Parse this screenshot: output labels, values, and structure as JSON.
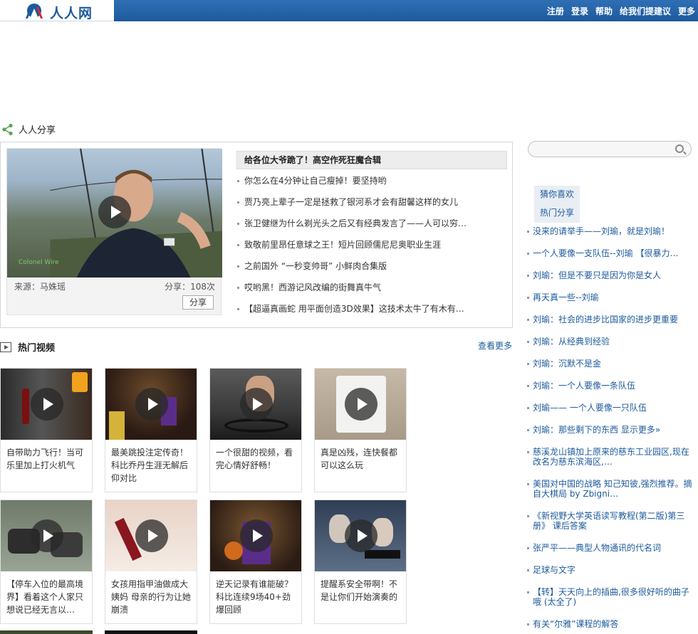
{
  "header": {
    "logo_text": "人人网",
    "nav": [
      "注册",
      "登录",
      "帮助",
      "给我们提建议",
      "更多"
    ]
  },
  "share_section": {
    "title": "人人分享",
    "feature": {
      "source": "来源：马姝瑶",
      "share_count": "分享：108次",
      "share_button": "分享",
      "watermark": "Colonel Wire"
    },
    "headline": "给各位大爷跪了！高空作死狂魔合辑",
    "items": [
      "你怎么在4分钟让自己瘦掉！要坚持哟",
      "贾乃亮上辈子一定是拯救了银河系才会有甜馨这样的女儿",
      "张卫健继为什么剃光头之后又有经典发言了——人可以穷…",
      "致敬前里昂任意球之王！短片回顾儒尼尼奥职业生涯",
      "之前国外 “一秒变帅哥” 小鲜肉合集版",
      "哎哟黑！西游记风改编的街舞真牛气",
      "【超逼真画蛇 用平面创造3D效果】这技术太牛了有木有…"
    ]
  },
  "video_section": {
    "title": "热门视频",
    "more": "查看更多",
    "videos": [
      {
        "caption": "自带助力飞行！当可乐里加上打火机气"
      },
      {
        "caption": "最美跳投注定传奇！科比乔丹生涯无解后仰对比"
      },
      {
        "caption": "一个很甜的视频，看完心情好舒畅！"
      },
      {
        "caption": "真是凶残，连快餐都可以这么玩"
      },
      {
        "caption": "【停车入位的最高境界】看着这个人家只想说已经无言以…"
      },
      {
        "caption": "女孩用指甲油做成大姨妈 母亲的行为让她崩溃"
      },
      {
        "caption": "逆天记录有谁能破？科比连续9场40+劲爆回顾"
      },
      {
        "caption": "提醒系安全带啊！不是让你们开始演奏的"
      }
    ]
  },
  "sidebar": {
    "search": {
      "placeholder": ""
    },
    "tabs": [
      "猜你喜欢",
      "热门分享"
    ],
    "items": [
      "没来的请举手——刘瑜，就是刘瑜！",
      "一个人要像一支队伍--刘瑜 【很暴力…",
      "刘瑜：但是不要只是因为你是女人",
      "再天真一些--刘瑜",
      "刘瑜：社会的进步比国家的进步更重要",
      "刘瑜：从经典到经验",
      "刘瑜：沉默不是金",
      "刘瑜：一个人要像一条队伍",
      "刘瑜—— 一个人要像一只队伍",
      "刘瑜：那些剩下的东西 显示更多»",
      "慈溪龙山镇加上原来的慈东工业园区,现在改名为慈东滨海区,…",
      "美国对中国的战略 知己知彼,强烈推荐。摘自大棋局 by Zbigni…",
      "《新视野大学英语读写教程(第二版)第三册》 课后答案",
      "张严平——典型人物通讯的代名词",
      "足球与文字",
      "【转】天天向上的插曲,很多很好听的曲子哦 (太全了)",
      "有关“尔雅”课程的解答"
    ]
  },
  "colors": {
    "brand_blue": "#1c5a9c",
    "link_blue": "#1c5a9c",
    "bar_gradient_top": "#2f6fb5"
  }
}
